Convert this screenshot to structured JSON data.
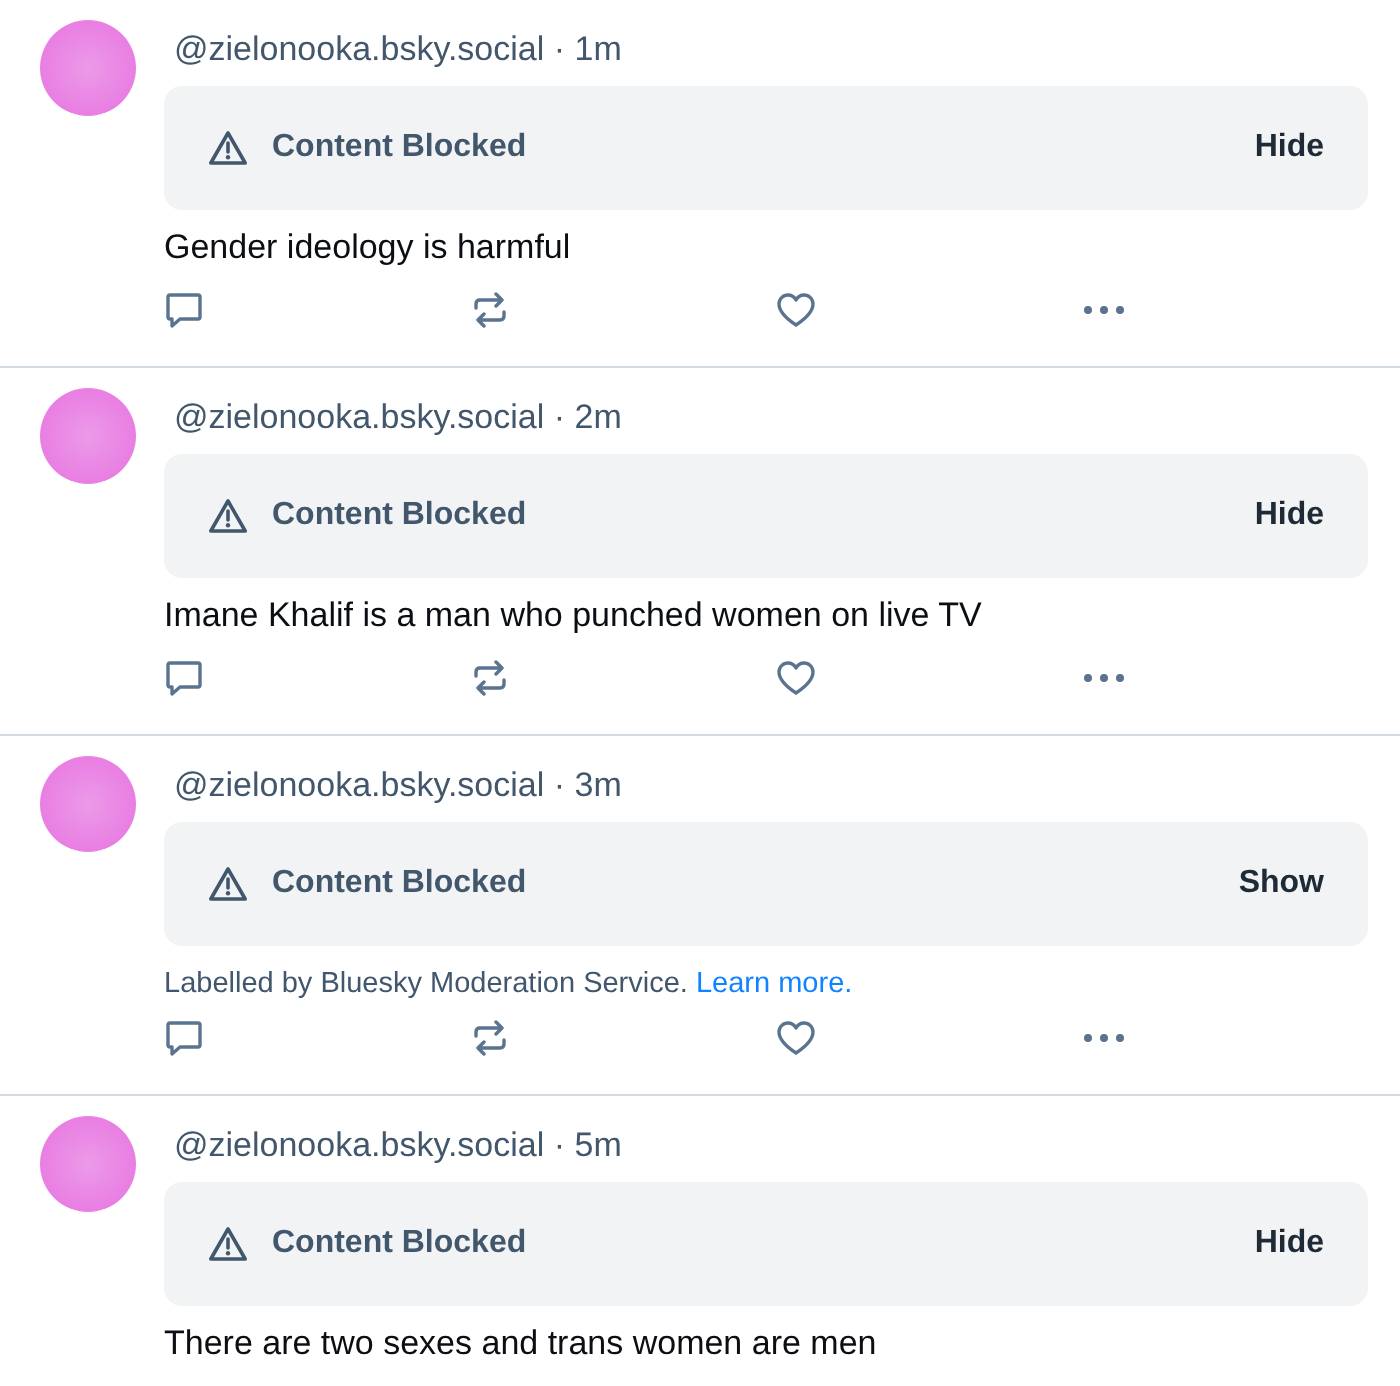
{
  "posts": [
    {
      "meta": "@zielonooka.bsky.social · 1m",
      "blocked_label": "Content Blocked",
      "toggle": "Hide",
      "kind": "text",
      "body": "Gender ideology is harmful",
      "show_actions": true
    },
    {
      "meta": "@zielonooka.bsky.social · 2m",
      "blocked_label": "Content Blocked",
      "toggle": "Hide",
      "kind": "text",
      "body": "Imane Khalif is a man who punched women on live TV",
      "show_actions": true
    },
    {
      "meta": "@zielonooka.bsky.social · 3m",
      "blocked_label": "Content Blocked",
      "toggle": "Show",
      "kind": "notice",
      "body": "Labelled by Bluesky Moderation Service.",
      "link": "Learn more.",
      "show_actions": true
    },
    {
      "meta": "@zielonooka.bsky.social · 5m",
      "blocked_label": "Content Blocked",
      "toggle": "Hide",
      "kind": "text",
      "body": "There are two sexes and trans women are men",
      "show_actions": false
    }
  ]
}
